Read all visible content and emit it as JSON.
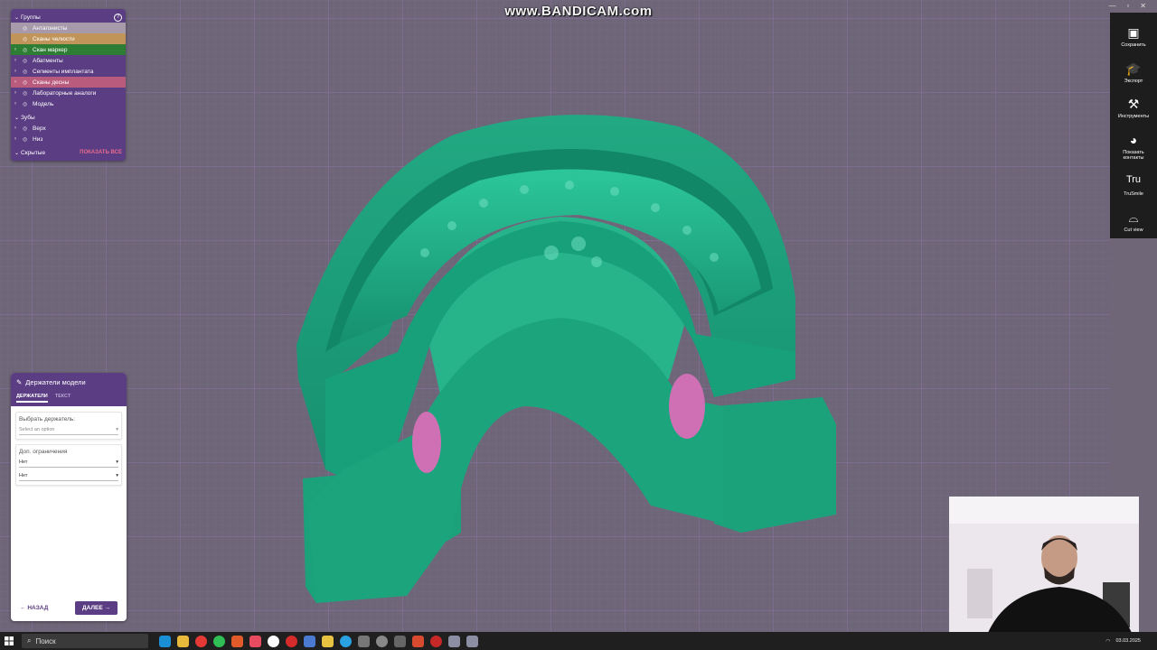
{
  "watermark": "www.BANDICAM.com",
  "groups_panel": {
    "title": "Группы",
    "items": [
      {
        "label": "Антагонисты",
        "bg": "#a79bab",
        "chevron": false
      },
      {
        "label": "Сканы челюсти",
        "bg": "#c1945a",
        "chevron": false
      },
      {
        "label": "Скан маркер",
        "bg": "#2d7d34",
        "chevron": true
      },
      {
        "label": "Абатменты",
        "bg": "transparent",
        "chevron": true
      },
      {
        "label": "Сегменты имплантата",
        "bg": "transparent",
        "chevron": true
      },
      {
        "label": "Сканы десны",
        "bg": "#b85b7c",
        "chevron": true
      },
      {
        "label": "Лабораторные аналоги",
        "bg": "transparent",
        "chevron": true
      },
      {
        "label": "Модель",
        "bg": "transparent",
        "chevron": true
      }
    ],
    "teeth_title": "Зубы",
    "teeth_items": [
      {
        "label": "Верх"
      },
      {
        "label": "Низ"
      }
    ],
    "hidden_label": "Скрытые",
    "show_all": "ПОКАЗАТЬ ВСЕ"
  },
  "holders_panel": {
    "title": "Держатели модели",
    "tabs": [
      "ДЕРЖАТЕЛИ",
      "ТЕКСТ"
    ],
    "select_holder_label": "Выбрать держатель:",
    "select_holder_placeholder": "Select an option",
    "constraints_label": "Доп. ограничения",
    "constraint_1": "Нет",
    "constraint_2": "Нет",
    "back": "НАЗАД",
    "next": "ДАЛЕЕ"
  },
  "toolbar": [
    {
      "label": "Сохранить",
      "icon": "save-icon"
    },
    {
      "label": "Экспорт",
      "icon": "export-icon"
    },
    {
      "label": "Инструменты",
      "icon": "tools-icon"
    },
    {
      "label": "Показать контакты",
      "icon": "teeth-icon"
    },
    {
      "label": "TruSmile",
      "icon": "trusmile-icon"
    },
    {
      "label": "Cut view",
      "icon": "cut-view-icon"
    }
  ],
  "taskbar": {
    "search": "Поиск",
    "date": "03.03.2025"
  },
  "colors": {
    "model": "#1c9e79",
    "model_dark": "#137a5c",
    "gum": "#cf6fb4",
    "panel": "#5a3d82"
  }
}
